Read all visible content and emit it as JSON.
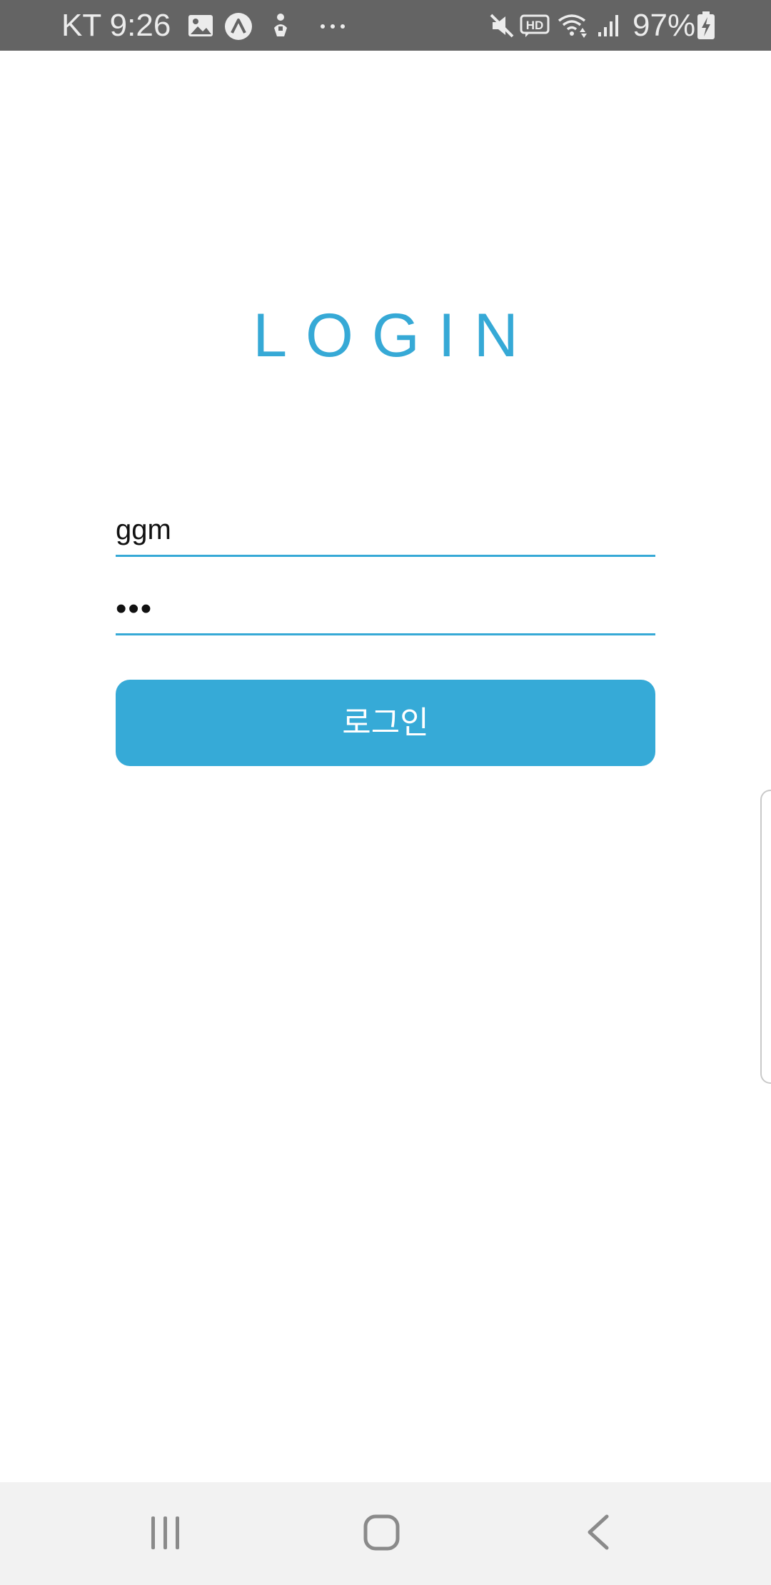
{
  "status_bar": {
    "carrier_time": "KT 9:26",
    "icons_left": [
      "image-icon",
      "app-a-icon",
      "accessibility-icon",
      "more-notifications-icon"
    ],
    "icons_right": [
      "mute-icon",
      "hd-voice-icon",
      "wifi-icon",
      "signal-icon",
      "battery-charging-icon"
    ],
    "battery_percent": "97%"
  },
  "login": {
    "title": "LOGIN",
    "username_value": "ggm",
    "password_value": "•••",
    "button_label": "로그인"
  },
  "nav_bar": {
    "buttons": [
      "recent-apps-icon",
      "home-icon",
      "back-icon"
    ]
  },
  "colors": {
    "accent": "#36a9d6",
    "status_bar_bg": "#646464",
    "nav_bar_bg": "#f2f2f2",
    "nav_icon": "#8a8a8a"
  }
}
